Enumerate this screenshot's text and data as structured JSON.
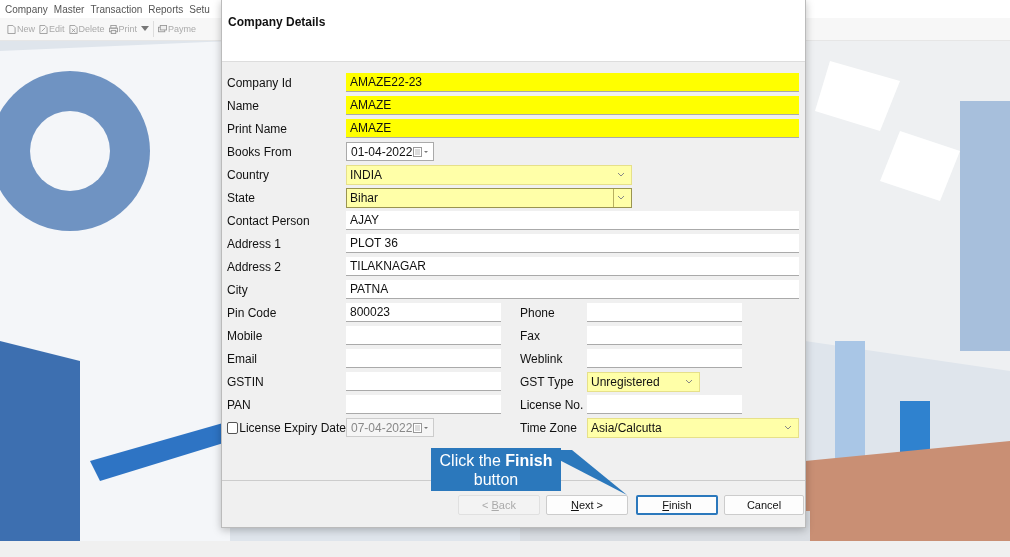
{
  "menu": [
    "Company",
    "Master",
    "Transaction",
    "Reports",
    "Setu"
  ],
  "toolbar": [
    {
      "label": "New",
      "kind": "new"
    },
    {
      "label": "Edit",
      "kind": "edit"
    },
    {
      "label": "Delete",
      "kind": "delete"
    },
    {
      "label": "Print",
      "kind": "print"
    },
    {
      "label": "Payme",
      "kind": "payment"
    }
  ],
  "dialog": {
    "title": "Company Details",
    "rows": [
      {
        "fields": [
          {
            "label": "Company Id",
            "value": "AMAZE22-23",
            "kind": "text",
            "required": true
          }
        ]
      },
      {
        "fields": [
          {
            "label": "Name",
            "value": "AMAZE",
            "kind": "text",
            "required": true
          }
        ]
      },
      {
        "fields": [
          {
            "label": "Print Name",
            "value": "AMAZE",
            "kind": "text",
            "required": true
          }
        ]
      },
      {
        "fields": [
          {
            "label": "Books From",
            "value": "01-04-2022",
            "kind": "date"
          }
        ]
      },
      {
        "fields": [
          {
            "label": "Country",
            "value": "INDIA",
            "kind": "combo",
            "focused": false
          }
        ]
      },
      {
        "fields": [
          {
            "label": "State",
            "value": "Bihar",
            "kind": "combo",
            "focused": true
          }
        ]
      },
      {
        "fields": [
          {
            "label": "Contact Person",
            "value": "AJAY",
            "kind": "text"
          }
        ]
      },
      {
        "fields": [
          {
            "label": "Address 1",
            "value": "PLOT 36",
            "kind": "text"
          }
        ]
      },
      {
        "fields": [
          {
            "label": "Address 2",
            "value": "TILAKNAGAR",
            "kind": "text"
          }
        ]
      },
      {
        "fields": [
          {
            "label": "City",
            "value": "PATNA",
            "kind": "text"
          }
        ]
      },
      {
        "fields": [
          {
            "label": "Pin Code",
            "value": "800023",
            "kind": "text"
          },
          {
            "label": "Phone",
            "kind": "text"
          }
        ]
      },
      {
        "fields": [
          {
            "label": "Mobile",
            "kind": "text"
          },
          {
            "label": "Fax",
            "kind": "text"
          }
        ]
      },
      {
        "fields": [
          {
            "label": "Email",
            "kind": "text"
          },
          {
            "label": "Weblink",
            "kind": "text"
          }
        ]
      },
      {
        "fields": [
          {
            "label": "GSTIN",
            "kind": "text"
          },
          {
            "label": "GST Type",
            "value": "Unregistered",
            "kind": "small-combo",
            "focused": false
          }
        ]
      },
      {
        "fields": [
          {
            "label": "PAN",
            "kind": "text"
          },
          {
            "label": "License No.",
            "kind": "text"
          }
        ]
      },
      {
        "fields": [
          {
            "label": "License Expiry Date",
            "value": "07-04-2022",
            "kind": "checkdate",
            "checked": false,
            "disabled": true
          },
          {
            "label": "Time Zone",
            "value": "Asia/Calcutta",
            "kind": "wide-combo",
            "focused": false
          }
        ]
      }
    ],
    "buttons": [
      {
        "prefix": "< ",
        "key": "B",
        "rest": "ack",
        "disabled": true,
        "default": false
      },
      {
        "key": "N",
        "rest": "ext >",
        "disabled": false,
        "default": false
      },
      {
        "key": "F",
        "rest": "inish",
        "disabled": false,
        "default": true
      },
      {
        "rest": "Cancel",
        "disabled": false,
        "default": false
      }
    ]
  },
  "callout": {
    "text": "Click the **Finish** button"
  }
}
